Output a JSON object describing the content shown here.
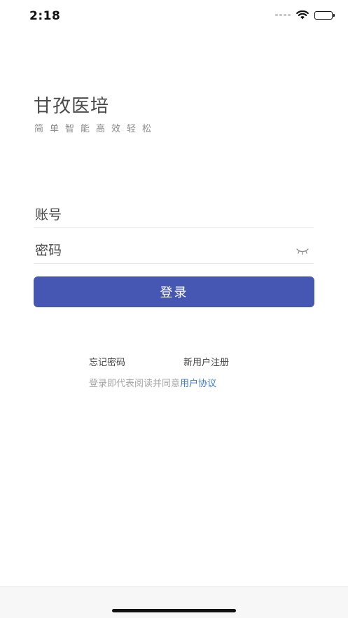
{
  "status_bar": {
    "time": "2:18",
    "icons": [
      "signal-icon",
      "wifi-icon",
      "battery-icon"
    ]
  },
  "brand": {
    "title": "甘孜医培",
    "subtitle": "简单智能高效轻松"
  },
  "form": {
    "username_placeholder": "账号",
    "password_placeholder": "密码",
    "password_toggle_icon": "eye-closed-icon",
    "login_label": "登录"
  },
  "links": {
    "forgot_password": "忘记密码",
    "register": "新用户注册"
  },
  "agreement": {
    "prefix": "登录即代表阅读并同意",
    "link": "用户协议"
  },
  "colors": {
    "primary": "#4656b3",
    "link": "#3a7bd5",
    "background": "#ffffff"
  }
}
